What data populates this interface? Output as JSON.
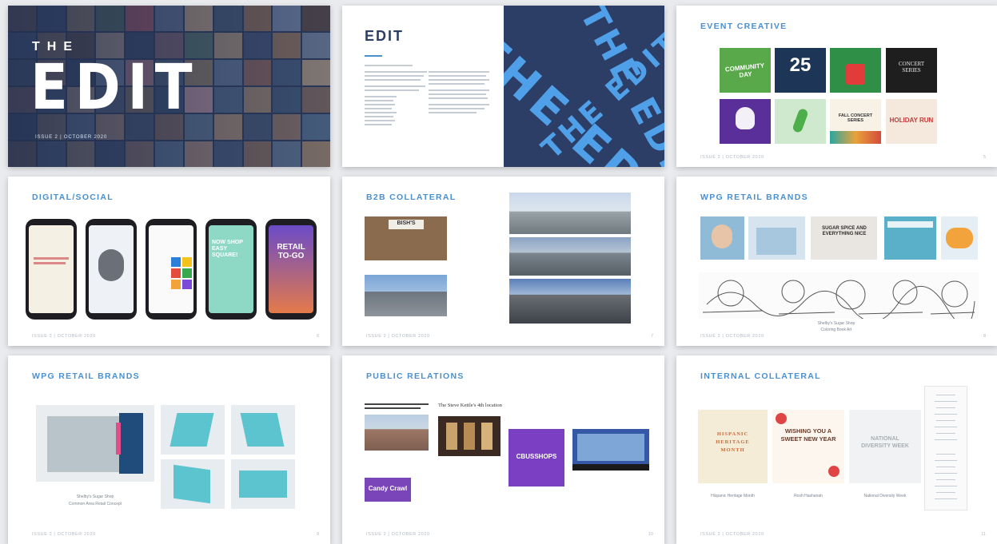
{
  "colors": {
    "accent": "#4a90d0",
    "navy": "#2c3e66",
    "light_blue": "#4fa0e8"
  },
  "footer": "ISSUE 2 | OCTOBER 2020",
  "cover": {
    "the": "THE",
    "edit": "EDIT",
    "issue": "ISSUE 2 | OCTOBER 2020"
  },
  "intro": {
    "logo": "EDIT",
    "art_words": [
      "THE EDIT",
      "THE EDIT",
      "THE EDIT"
    ]
  },
  "slides": {
    "event": {
      "title": "EVENT CREATIVE",
      "tiles": [
        "COMMUNITY DAY",
        "25",
        "",
        "CONCERT SERIES",
        "",
        "",
        "FALL CONCERT SERIES",
        "HOLIDAY RUN"
      ]
    },
    "digital": {
      "title": "DIGITAL/SOCIAL",
      "phones": [
        "",
        "",
        "",
        "NOW SHOP EASY SQUARE!",
        "RETAIL TO-GO"
      ]
    },
    "b2b": {
      "title": "B2B COLLATERAL",
      "sign": "BISH'S"
    },
    "wpg1": {
      "title": "WPG RETAIL BRANDS",
      "sugar_text": "SUGAR SPICE AND EVERYTHING NICE",
      "caption": [
        "Shelby's Sugar Shop",
        "Coloring Book Art"
      ]
    },
    "wpg2": {
      "title": "WPG RETAIL BRANDS",
      "caption": [
        "Shelby's Sugar Shop",
        "Common Area Retail Concept"
      ]
    },
    "pr": {
      "title": "PUBLIC RELATIONS",
      "article_title": "The Steve Kettle's 4th location",
      "candy": "Candy Crawl",
      "cbus": "CBUSSHOPS"
    },
    "internal": {
      "title": "INTERNAL COLLATERAL",
      "card1": "HISPANIC HERITAGE MONTH",
      "card2": "WISHING YOU A SWEET NEW YEAR",
      "card3": "NATIONAL DIVERSITY WEEK",
      "captions": [
        "Hispanic Heritage Month",
        "Rosh Hashanah",
        "National Diversity Week"
      ]
    }
  },
  "page_numbers": [
    "3",
    "4",
    "5",
    "6",
    "7",
    "8",
    "9",
    "10",
    "11"
  ]
}
